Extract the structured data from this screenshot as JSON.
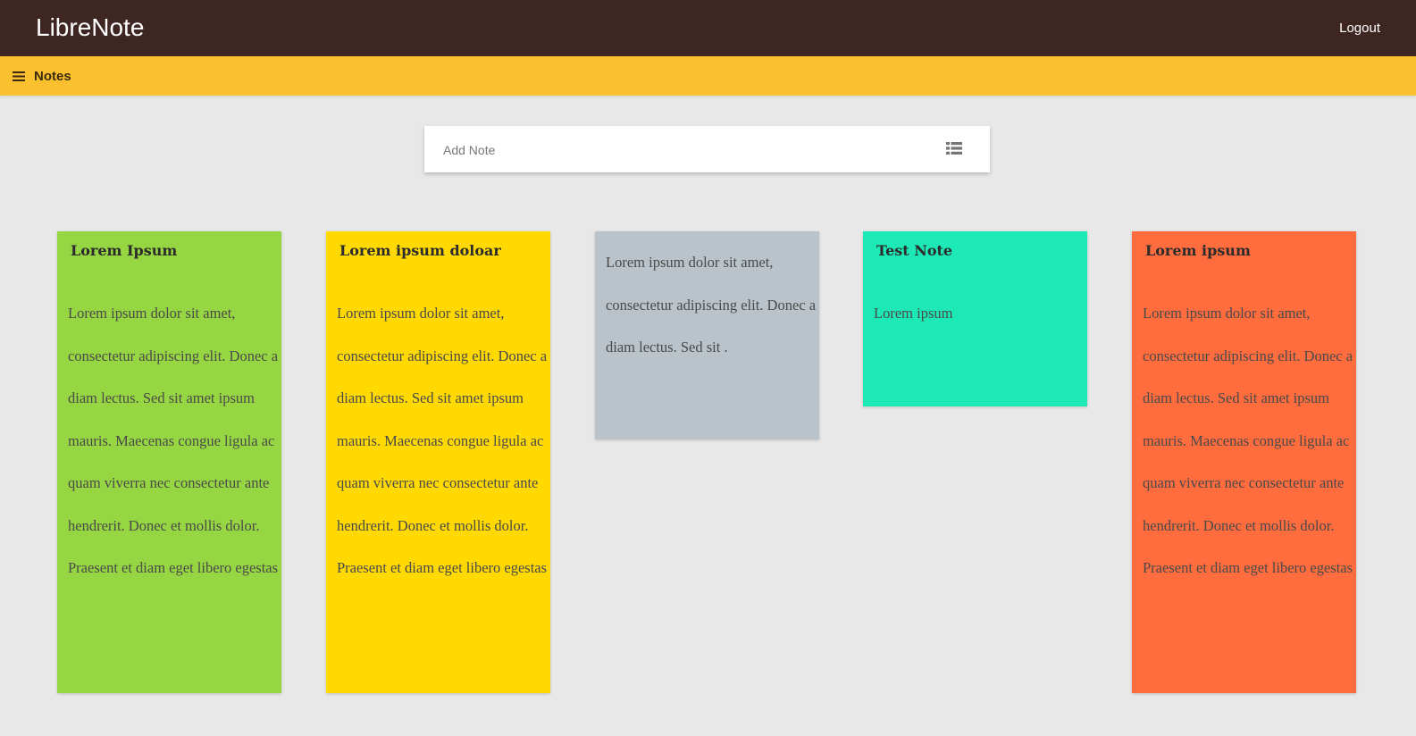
{
  "app": {
    "title": "LibreNote",
    "logout_label": "Logout"
  },
  "subnav": {
    "label": "Notes",
    "menu_icon": "hamburger-menu-icon"
  },
  "add_note": {
    "placeholder": "Add Note",
    "value": "",
    "toggle_icon": "list-view-icon"
  },
  "colors": {
    "topbar": "#3e2723",
    "subbar": "#fbc02d",
    "background": "#e8e8e8"
  },
  "notes": [
    {
      "title": "Lorem Ipsum",
      "body": "Lorem ipsum dolor sit amet, consectetur adipiscing elit. Donec a diam lectus. Sed sit amet ipsum mauris. Maecenas congue ligula ac quam viverra nec consectetur ante hendrerit. Donec et mollis dolor. Praesent et diam eget libero egestas",
      "color": "#96d642"
    },
    {
      "title": "Lorem ipsum doloar",
      "body": "Lorem ipsum dolor sit amet, consectetur adipiscing elit. Donec a diam lectus. Sed sit amet ipsum mauris. Maecenas congue ligula ac quam viverra nec consectetur ante hendrerit. Donec et mollis dolor. Praesent et diam eget libero egestas",
      "color": "#ffd900"
    },
    {
      "title": "",
      "body": "Lorem ipsum dolor sit amet, consectetur adipiscing elit. Donec a diam lectus. Sed sit .",
      "color": "#b9c3c9"
    },
    {
      "title": "Test Note",
      "body": "Lorem ipsum",
      "color": "#1de9b6"
    },
    {
      "title": "Lorem ipsum",
      "body": "Lorem ipsum dolor sit amet, consectetur adipiscing elit. Donec a diam lectus. Sed sit amet ipsum mauris. Maecenas congue ligula ac quam viverra nec consectetur ante hendrerit. Donec et mollis dolor. Praesent et diam eget libero egestas",
      "color": "#ff6c3e"
    }
  ]
}
